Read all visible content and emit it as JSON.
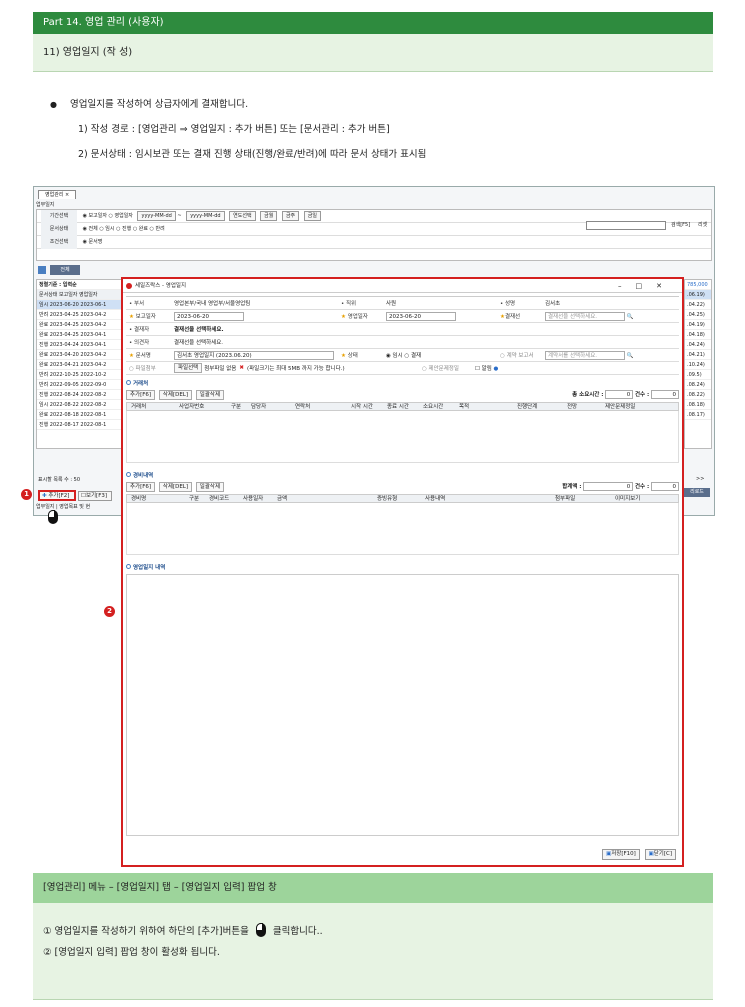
{
  "header": {
    "part": "Part 14. 영업 관리 (사용자)",
    "section": "11) 영업일지 (작 성)"
  },
  "intro": {
    "main": "영업일지를 작성하여 상급자에게 결재합니다.",
    "line1": "1) 작성 경로 : [영업관리 ⇒ 영업일지 : 추가 버튼] 또는 [문서관리 : 추가 버튼]",
    "line2": "2) 문서상태 : 임시보관 또는 결재 진행 상태(진행/완료/반려)에 따라 문서 상태가 표시됨"
  },
  "app": {
    "tab": "영업관리 ×",
    "crumb": "업무일지",
    "filters": {
      "period_label": "기간선택",
      "period_opts": "◉ 보고일자 ○ 영업일자",
      "date_from": "yyyy-MM-dd",
      "date_to": "yyyy-MM-dd",
      "year_select": "연도선택",
      "btn_month": "금월",
      "btn_week": "금주",
      "btn_day": "금일",
      "status_label": "문서상태",
      "status_opts": "◉ 전체 ○ 임시 ○ 진행 ○ 완료 ○ 반려",
      "cond_label": "조건선택",
      "cond_opt": "◉ 문서명",
      "search_btn": "검색[F5]",
      "reset_btn": "리셋"
    },
    "all_btn": "전체",
    "list_title": "정렬기준 : 입력순",
    "list_headers": [
      "문서상태",
      "보고일자",
      "영업일자"
    ],
    "list_rows": [
      [
        "임시",
        "2023-06-20",
        "2023-06-1"
      ],
      [
        "반려",
        "2023-04-25",
        "2023-04-2"
      ],
      [
        "완료",
        "2023-04-25",
        "2023-04-2"
      ],
      [
        "완료",
        "2023-04-25",
        "2023-04-1"
      ],
      [
        "진행",
        "2023-04-24",
        "2023-04-1"
      ],
      [
        "완료",
        "2023-04-20",
        "2023-04-2"
      ],
      [
        "완료",
        "2023-04-21",
        "2023-04-2"
      ],
      [
        "반려",
        "2022-10-25",
        "2022-10-2"
      ],
      [
        "반려",
        "2022-09-05",
        "2022-09-0"
      ],
      [
        "진행",
        "2022-08-24",
        "2022-08-2"
      ],
      [
        "임시",
        "2022-08-22",
        "2022-08-2"
      ],
      [
        "완료",
        "2022-08-18",
        "2022-08-1"
      ],
      [
        "진행",
        "2022-08-17",
        "2022-08-1"
      ]
    ],
    "right_col": [
      "785,000",
      ".06.19)",
      ".04.22)",
      ".04.25)",
      ".04.19)",
      ".04.18)",
      ".04.24)",
      ".04.21)",
      ".10.24)",
      ".09.5)",
      ".08.24)",
      ".08.22)",
      ".08.18)",
      ".08.17)"
    ],
    "pager": "표시할 목록 수 : 50",
    "pager_next": ">>",
    "add_btn": "추가[F2]",
    "view_btn": "보기[F3]",
    "bottom_tabs": "업무일지 | 영업목표 및 현",
    "right_btn": "리로드"
  },
  "popup": {
    "title": "세일즈락스 - 영업일지",
    "dept_label": "부서",
    "dept_value": "영업본부/국내 영업부/서울영업팀",
    "rank_label": "직위",
    "rank_value": "사원",
    "name_label": "성명",
    "name_value": "김서초",
    "report_date_label": "보고일자",
    "report_date": "2023-06-20",
    "sales_date_label": "영업일자",
    "sales_date": "2023-06-20",
    "approver_label": "결재선",
    "approver_ph": "결재선을 선택하세요.",
    "approver2_label": "결재자",
    "approver2_value": "결재선을 선택하세요.",
    "opinion_label": "의견자",
    "opinion_value": "결재선을 선택하세요.",
    "docname_label": "문서명",
    "docname_value": "김서초 영업일지 (2023.06.20)",
    "state_label": "상태",
    "state_value": "◉ 임시 ○ 결재",
    "contract_label": "계약 보고서",
    "contract_ph": "계약서를 선택하세요.",
    "attach_label": "파일첨부",
    "attach_btn": "파일선택",
    "attach_text": "첨부파일 없음",
    "attach_note": "(파일크기는 최대 5MB 까지 가능 합니다.)",
    "propose_label": "제안문제정일",
    "notice_label": "알림",
    "clients": {
      "title": "거래처",
      "add": "추가[F6]",
      "del": "삭제[DEL]",
      "delall": "일괄삭제",
      "total_time": "총 소요시간 :",
      "total_time_val": "0",
      "count": "건수 :",
      "count_val": "0",
      "cols": [
        "거래처",
        "사업자번호",
        "구분",
        "담당자",
        "연락처",
        "시작 시간",
        "종료 시간",
        "소요시간",
        "목적",
        "진행단계",
        "전망",
        "제안문제정일"
      ]
    },
    "expenses": {
      "title": "경비내역",
      "add": "추가[F6]",
      "del": "삭제[DEL]",
      "delall": "일괄삭제",
      "sum": "합계액 :",
      "sum_val": "0",
      "count": "건수 :",
      "count_val": "0",
      "cols": [
        "경비명",
        "구분",
        "경비코드",
        "사용일자",
        "금액",
        "증빙유형",
        "사용내역",
        "첨부파일",
        "이미지보기"
      ]
    },
    "memo_title": "영업일지 내역",
    "save_btn": "저장[F10]",
    "close_btn": "닫기[C]"
  },
  "bottom": {
    "title": "[영업관리] 메뉴 – [영업일지] 탭 – [영업일지 입력] 팝업 창",
    "step1_pre": "①  영업일지를 작성하기 위하여 하단의 [추가]버튼을",
    "step1_post": "클릭합니다..",
    "step2": "②  [영업일지 입력]  팝업 창이 활성화 됩니다."
  },
  "colors": {
    "header_dark": "#2e8b3e",
    "header_light": "#e7f3e3",
    "highlight": "#d42020"
  }
}
